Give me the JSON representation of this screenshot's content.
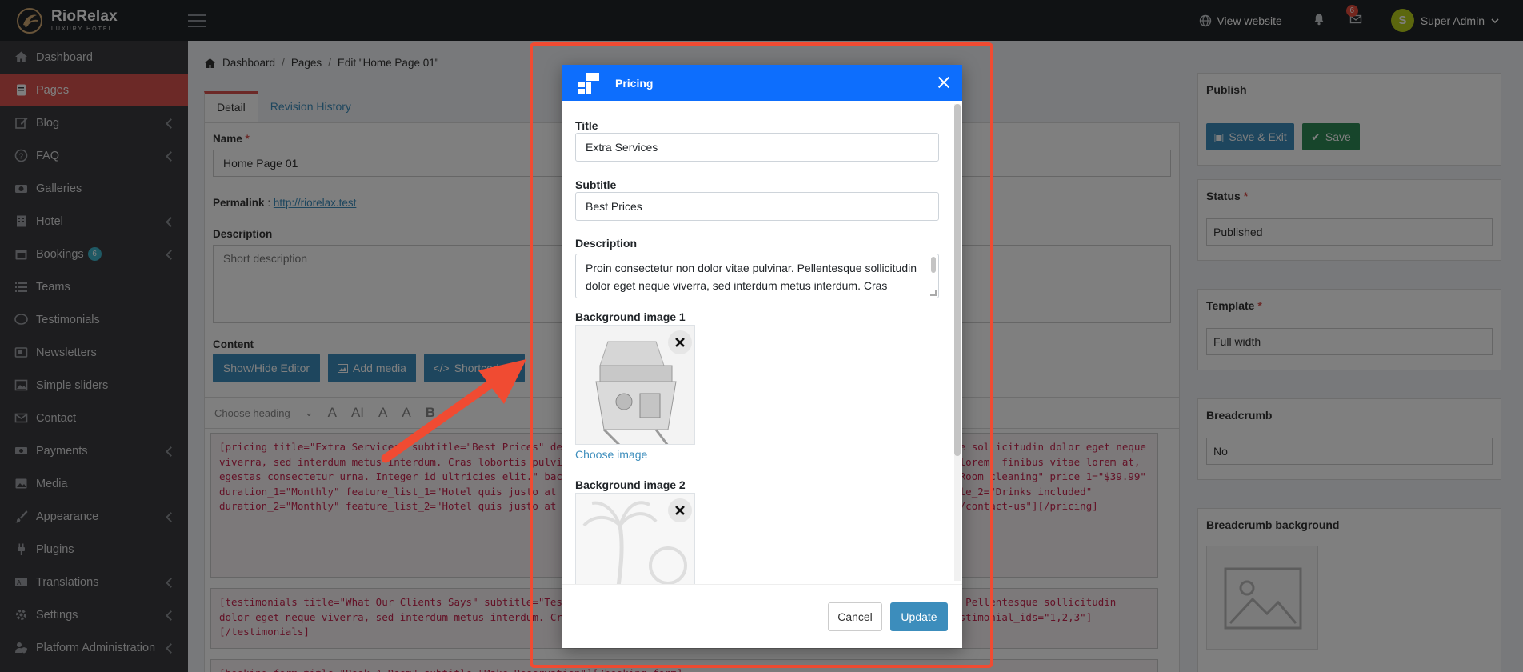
{
  "topbar": {
    "brand_name": "RioRelax",
    "brand_sub": "LUXURY HOTEL",
    "view_website": "View website",
    "mail_count": "6",
    "user_initial": "S",
    "user_name": "Super Admin"
  },
  "sidebar": {
    "items": [
      {
        "label": "Dashboard",
        "icon": "home-icon",
        "has_children": false
      },
      {
        "label": "Pages",
        "icon": "page-icon",
        "active": true,
        "has_children": false
      },
      {
        "label": "Blog",
        "icon": "edit-icon",
        "has_children": true
      },
      {
        "label": "FAQ",
        "icon": "question-icon",
        "has_children": true
      },
      {
        "label": "Galleries",
        "icon": "camera-icon",
        "has_children": false
      },
      {
        "label": "Hotel",
        "icon": "building-icon",
        "has_children": true
      },
      {
        "label": "Bookings",
        "icon": "calendar-icon",
        "badge": "6",
        "has_children": true
      },
      {
        "label": "Teams",
        "icon": "list-icon",
        "has_children": false
      },
      {
        "label": "Testimonials",
        "icon": "comment-icon",
        "has_children": false
      },
      {
        "label": "Newsletters",
        "icon": "newsletter-icon",
        "has_children": false
      },
      {
        "label": "Simple sliders",
        "icon": "image-icon",
        "has_children": false
      },
      {
        "label": "Contact",
        "icon": "envelope-icon",
        "has_children": false
      },
      {
        "label": "Payments",
        "icon": "money-icon",
        "has_children": true
      },
      {
        "label": "Media",
        "icon": "media-icon",
        "has_children": false
      },
      {
        "label": "Appearance",
        "icon": "brush-icon",
        "has_children": true
      },
      {
        "label": "Plugins",
        "icon": "plug-icon",
        "has_children": false
      },
      {
        "label": "Translations",
        "icon": "language-icon",
        "has_children": true
      },
      {
        "label": "Settings",
        "icon": "cogs-icon",
        "has_children": true
      },
      {
        "label": "Platform Administration",
        "icon": "user-shield-icon",
        "has_children": true
      }
    ]
  },
  "main": {
    "breadcrumb": [
      "Dashboard",
      "Pages",
      "Edit \"Home Page 01\""
    ],
    "tabs": [
      "Detail",
      "Revision History"
    ],
    "name_label": "Name",
    "name_value": "Home Page 01",
    "permalink_label": "Permalink",
    "permalink_sep": ":",
    "permalink_url": "http://riorelax.test",
    "description_label": "Description",
    "description_placeholder": "Short description",
    "content_label": "Content",
    "btn_show_hide": "Show/Hide Editor",
    "btn_add_media": "Add media",
    "btn_shortcode": "Shortcode",
    "heading_select": "Choose heading",
    "code_1": "[pricing title=\"Extra Services\" subtitle=\"Best Prices\" description=\"Proin consectetur non dolor vitae pulvinar. Pellentesque sollicitudin dolor eget neque viverra, sed interdum metus interdum. Cras lobortis pulvinar dolor, sit amet ullamcorper dolor iaculis vel. Integer ligula lorem, finibus vitae lorem at, egestas consectetur urna. Integer id ultricies elit.\" background_image_2=\"backgrounds/an-img-02.png\" quantity=\"2\" title_1=\"Room cleaning\" price_1=\"$39.99\" duration_1=\"Monthly\" feature_list_1=\"Hotel quis justo at lorem\" button_label_1=\"Get Started\" button_url_1=\"/contact-us\" title_2=\"Drinks included\" duration_2=\"Monthly\" feature_list_2=\"Hotel quis justo at lorem, Fusce sodales\" button_label_2=\"Get Started \" button_url_2=\"/contact-us\"][/pricing]",
    "code_2": "[testimonials title=\"What Our Clients Says\" subtitle=\"Testimonial\" description=\"Proin consectetur non dolor vitae pulvinar. Pellentesque sollicitudin dolor eget neque viverra, sed interdum metus interdum. Cras lobortis\" background_image=\"/backgrounds/testimonial-bg.png\" testimonial_ids=\"1,2,3\"][/testimonials]",
    "code_3": "[booking-form title=\"Book A Room\" subtitle=\"Make Reservation\"][/booking-form]"
  },
  "right": {
    "publish_title": "Publish",
    "save_exit": "Save & Exit",
    "save": "Save",
    "status_label": "Status",
    "status_value": "Published",
    "template_label": "Template",
    "template_value": "Full width",
    "breadcrumb_label": "Breadcrumb",
    "breadcrumb_value": "No",
    "breadcrumb_bg_label": "Breadcrumb background"
  },
  "modal": {
    "title": "Pricing",
    "title_label": "Title",
    "title_value": "Extra Services",
    "subtitle_label": "Subtitle",
    "subtitle_value": "Best Prices",
    "description_label": "Description",
    "description_value": "Proin consectetur non dolor vitae pulvinar. Pellentesque sollicitudin dolor eget neque viverra, sed interdum metus interdum. Cras lobortis pulvinar dolor, sit amet ullamcorper dolor iaculis vel.",
    "bg1_label": "Background image 1",
    "choose_image": "Choose image",
    "bg2_label": "Background image 2",
    "cancel": "Cancel",
    "update": "Update"
  },
  "colors": {
    "topbar": "#212428",
    "sidebar": "#3a3b3e",
    "active_nav": "#d9534f",
    "modal_header": "#0d6efd",
    "annotation": "#f04b32",
    "primary_button": "#3c8dbc"
  }
}
